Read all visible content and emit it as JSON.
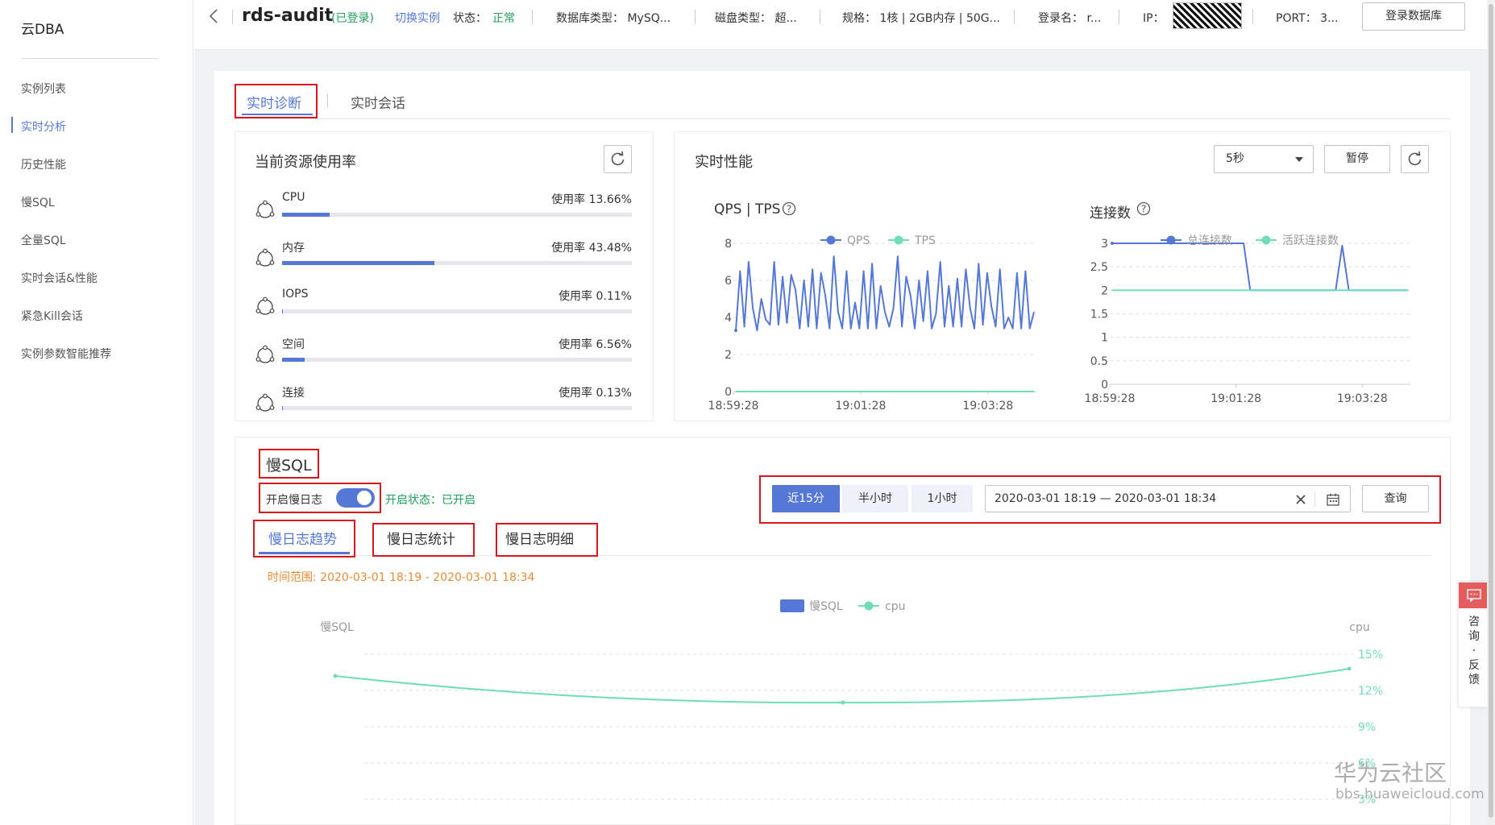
{
  "sidebar": {
    "brand": "云DBA",
    "items": [
      "实例列表",
      "实时分析",
      "历史性能",
      "慢SQL",
      "全量SQL",
      "实时会话&性能",
      "紧急Kill会话",
      "实例参数智能推荐"
    ],
    "active_index": 1
  },
  "header": {
    "back_icon": "chevron-left-icon",
    "instance_name": "rds-audit",
    "login_state": "(已登录)",
    "switch_instance": "切换实例",
    "status_label": "状态：",
    "status_value": "正常",
    "db_type": "数据库类型： MySQ...",
    "disk_type": "磁盘类型： 超...",
    "spec": "规格： 1核 | 2GB内存 | 50G...",
    "login_name": "登录名： r...",
    "ip_label": "IP：",
    "port": "PORT： 3...",
    "login_db_button": "登录数据库"
  },
  "tabs": {
    "diagnosis": "实时诊断",
    "session": "实时会话"
  },
  "resource": {
    "title": "当前资源使用率",
    "refresh_icon": "refresh-icon",
    "items": [
      {
        "name": "CPU",
        "usage": "使用率 13.66%",
        "pct": 13.66
      },
      {
        "name": "内存",
        "usage": "使用率 43.48%",
        "pct": 43.48
      },
      {
        "name": "IOPS",
        "usage": "使用率 0.11%",
        "pct": 0.11
      },
      {
        "name": "空间",
        "usage": "使用率 6.56%",
        "pct": 6.56
      },
      {
        "name": "连接",
        "usage": "使用率 0.13%",
        "pct": 0.13
      }
    ]
  },
  "perf": {
    "title": "实时性能",
    "interval": "5秒",
    "pause": "暂停",
    "qps_title": "QPS | TPS",
    "conn_title": "连接数",
    "help_icon": "help-circle-icon"
  },
  "slow": {
    "title": "慢SQL",
    "toggle_label": "开启慢日志",
    "toggle_on": true,
    "status_text": "开启状态：已开启",
    "ranges": [
      "近15分",
      "半小时",
      "1小时"
    ],
    "active_range": 0,
    "date_range": "2020-03-01 18:19 — 2020-03-01 18:34",
    "query": "查询",
    "subtabs": [
      "慢日志趋势",
      "慢日志统计",
      "慢日志明细"
    ],
    "time_range_text": "时间范围: 2020-03-01 18:19 - 2020-03-01 18:34"
  },
  "feedback": {
    "text": "咨询·反馈"
  },
  "watermark": {
    "line1": "华为云社区",
    "line2": "bbs.huaweicloud.com"
  },
  "colors": {
    "accent": "#5578d6",
    "teal": "#6fddb7",
    "red_box": "#d8161c",
    "green": "#1ea05a",
    "orange": "#e88a36"
  },
  "chart_data": [
    {
      "type": "line",
      "title": "QPS | TPS",
      "x_ticks": [
        "18:59:28",
        "19:01:28",
        "19:03:28"
      ],
      "ylim": [
        0,
        8
      ],
      "y_ticks": [
        0,
        2,
        4,
        6,
        8
      ],
      "series": [
        {
          "name": "QPS",
          "color": "#5578d6",
          "values": [
            3.3,
            6.5,
            3.5,
            7.0,
            4.5,
            3.3,
            5.0,
            3.9,
            3.6,
            7.0,
            3.6,
            6.2,
            3.7,
            6.3,
            5.5,
            3.4,
            6.0,
            3.5,
            6.6,
            3.4,
            6.4,
            5.2,
            3.4,
            7.3,
            4.3,
            3.4,
            6.5,
            3.4,
            4.8,
            3.4,
            6.5,
            3.4,
            6.9,
            3.4,
            5.7,
            4.3,
            3.5,
            4.5,
            7.3,
            3.5,
            6.2,
            5.2,
            3.4,
            6.0,
            3.8,
            6.5,
            3.4,
            4.2,
            7.0,
            3.5,
            5.7,
            3.5,
            6.1,
            3.5,
            6.6,
            4.5,
            3.4,
            6.9,
            3.6,
            6.4,
            4.6,
            3.5,
            6.6,
            3.4,
            4.0,
            3.4,
            6.4,
            3.4,
            6.5,
            3.4,
            4.3
          ]
        },
        {
          "name": "TPS",
          "color": "#6fddb7",
          "values": [
            0,
            0,
            0,
            0,
            0,
            0,
            0,
            0,
            0,
            0,
            0,
            0,
            0,
            0,
            0,
            0,
            0,
            0,
            0,
            0,
            0,
            0,
            0,
            0,
            0,
            0,
            0,
            0,
            0,
            0,
            0,
            0,
            0,
            0,
            0,
            0,
            0,
            0,
            0,
            0,
            0,
            0,
            0,
            0,
            0,
            0,
            0,
            0,
            0,
            0,
            0,
            0,
            0,
            0,
            0,
            0,
            0,
            0,
            0,
            0,
            0,
            0,
            0,
            0,
            0,
            0,
            0,
            0,
            0,
            0,
            0
          ]
        }
      ]
    },
    {
      "type": "line",
      "title": "连接数",
      "x_ticks": [
        "18:59:28",
        "19:01:28",
        "19:03:28"
      ],
      "ylim": [
        0,
        3
      ],
      "y_ticks": [
        0,
        0.5,
        1,
        1.5,
        2,
        2.5,
        3
      ],
      "series": [
        {
          "name": "总连接数",
          "color": "#5578d6",
          "values": [
            3,
            3,
            3,
            3,
            3,
            3,
            3,
            3,
            3,
            3,
            3,
            3,
            3,
            3,
            3,
            3,
            3,
            3,
            3,
            3,
            3,
            2,
            2,
            2,
            2,
            2,
            2,
            2,
            2,
            2,
            2,
            2,
            2,
            2,
            2,
            2.95,
            2,
            2,
            2,
            2,
            2,
            2,
            2,
            2,
            2,
            2
          ]
        },
        {
          "name": "活跃连接数",
          "color": "#6fddb7",
          "values": [
            2,
            2,
            2,
            2,
            2,
            2,
            2,
            2,
            2,
            2,
            2,
            2,
            2,
            2,
            2,
            2,
            2,
            2,
            2,
            2,
            2,
            2,
            2,
            2,
            2,
            2,
            2,
            2,
            2,
            2,
            2,
            2,
            2,
            2,
            2,
            2,
            2,
            2,
            2,
            2,
            2,
            2,
            2,
            2,
            2,
            2
          ]
        }
      ]
    },
    {
      "type": "line",
      "title": "",
      "ylabel_left": "慢SQL",
      "ylabel_right": "cpu",
      "y_ticks_right": [
        "15%",
        "12%",
        "9%",
        "6%",
        "3%"
      ],
      "ylim_right": [
        0,
        15
      ],
      "series": [
        {
          "name": "慢SQL",
          "color": "#5578d6",
          "values": []
        },
        {
          "name": "cpu",
          "color": "#6fddb7",
          "values": [
            13.2,
            11.0,
            13.8
          ]
        }
      ]
    }
  ]
}
